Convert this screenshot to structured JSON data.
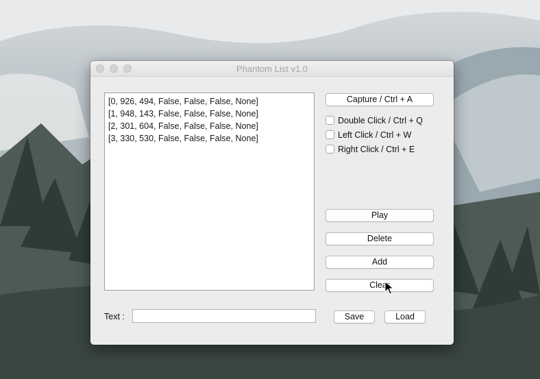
{
  "window": {
    "title": "Phantom List v1.0"
  },
  "list": {
    "items": [
      "[0, 926, 494, False, False, False, None]",
      "[1, 948, 143, False, False, False, None]",
      "[2, 301, 604, False, False, False, None]",
      "[3, 330, 530, False, False, False, None]"
    ]
  },
  "buttons": {
    "capture": "Capture / Ctrl + A",
    "play": "Play",
    "delete": "Delete",
    "add": "Add",
    "clear": "Clear",
    "save": "Save",
    "load": "Load"
  },
  "checkboxes": {
    "double_click": "Double Click / Ctrl + Q",
    "left_click": "Left Click / Ctrl + W",
    "right_click": "Right Click / Ctrl + E"
  },
  "text_field": {
    "label": "Text :",
    "value": ""
  }
}
